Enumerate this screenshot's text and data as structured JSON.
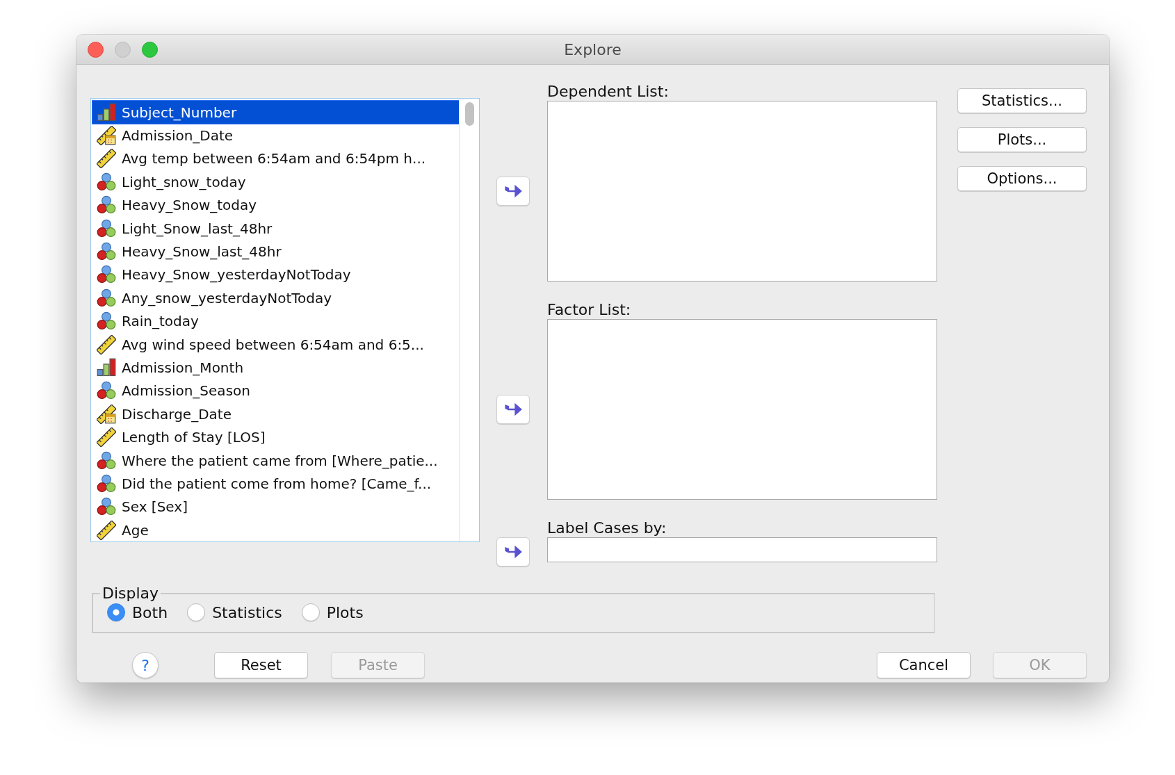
{
  "window": {
    "title": "Explore"
  },
  "variables": [
    {
      "name": "Subject_Number",
      "kind": "ordinal",
      "selected": true
    },
    {
      "name": "Admission_Date",
      "kind": "date",
      "selected": false
    },
    {
      "name": "Avg temp between 6:54am and 6:54pm h...",
      "kind": "scale",
      "selected": false
    },
    {
      "name": "Light_snow_today",
      "kind": "nominal",
      "selected": false
    },
    {
      "name": "Heavy_Snow_today",
      "kind": "nominal",
      "selected": false
    },
    {
      "name": "Light_Snow_last_48hr",
      "kind": "nominal",
      "selected": false
    },
    {
      "name": "Heavy_Snow_last_48hr",
      "kind": "nominal",
      "selected": false
    },
    {
      "name": "Heavy_Snow_yesterdayNotToday",
      "kind": "nominal",
      "selected": false
    },
    {
      "name": "Any_snow_yesterdayNotToday",
      "kind": "nominal",
      "selected": false
    },
    {
      "name": "Rain_today",
      "kind": "nominal",
      "selected": false
    },
    {
      "name": "Avg wind speed between 6:54am and 6:5...",
      "kind": "scale",
      "selected": false
    },
    {
      "name": "Admission_Month",
      "kind": "ordinal",
      "selected": false
    },
    {
      "name": "Admission_Season",
      "kind": "nominal",
      "selected": false
    },
    {
      "name": "Discharge_Date",
      "kind": "date",
      "selected": false
    },
    {
      "name": "Length of Stay [LOS]",
      "kind": "scale",
      "selected": false
    },
    {
      "name": "Where the patient came from [Where_patie...",
      "kind": "nominal",
      "selected": false
    },
    {
      "name": "Did the patient come from home? [Came_f...",
      "kind": "nominal",
      "selected": false
    },
    {
      "name": "Sex [Sex]",
      "kind": "nominal",
      "selected": false
    },
    {
      "name": "Age",
      "kind": "scale",
      "selected": false
    }
  ],
  "target_lists": [
    {
      "label": "Dependent List:",
      "kind": "list"
    },
    {
      "label": "Factor List:",
      "kind": "list"
    },
    {
      "label": "Label Cases by:",
      "kind": "field"
    }
  ],
  "side_buttons": [
    "Statistics...",
    "Plots...",
    "Options..."
  ],
  "display": {
    "legend": "Display",
    "options": [
      {
        "label": "Both",
        "selected": true
      },
      {
        "label": "Statistics",
        "selected": false
      },
      {
        "label": "Plots",
        "selected": false
      }
    ]
  },
  "left_buttons": [
    {
      "label": "Reset",
      "disabled": false
    },
    {
      "label": "Paste",
      "disabled": true
    }
  ],
  "right_buttons": [
    {
      "label": "Cancel",
      "disabled": false
    },
    {
      "label": "OK",
      "disabled": true
    }
  ],
  "help": {
    "label": "?"
  }
}
